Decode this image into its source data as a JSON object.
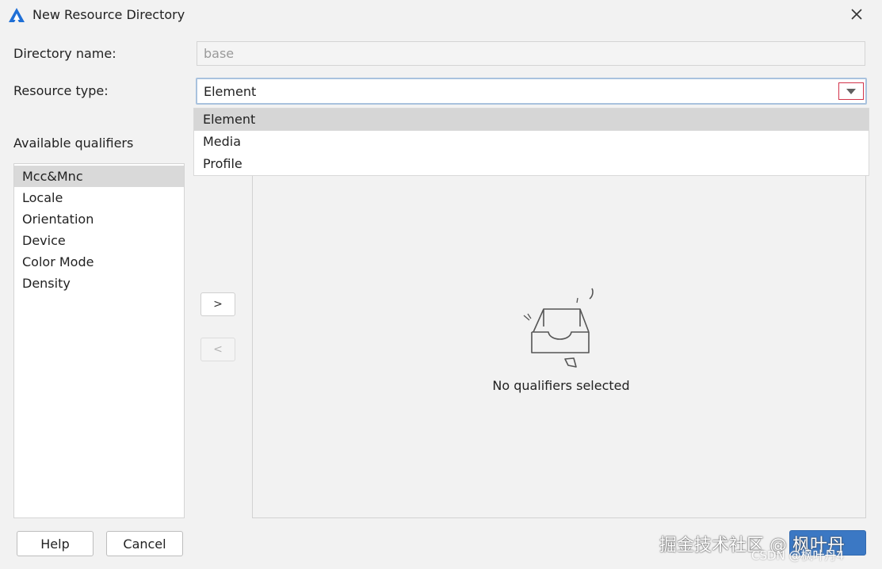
{
  "window": {
    "title": "New Resource Directory"
  },
  "form": {
    "directory_name_label": "Directory name:",
    "directory_name_value": "base",
    "resource_type_label": "Resource type:",
    "resource_type_value": "Element"
  },
  "dropdown": {
    "options": [
      "Element",
      "Media",
      "Profile"
    ],
    "selected": "Element"
  },
  "qualifiers": {
    "available_label": "Available qualifiers",
    "items": [
      "Mcc&Mnc",
      "Locale",
      "Orientation",
      "Device",
      "Color Mode",
      "Density"
    ],
    "selected": "Mcc&Mnc",
    "add_label": ">",
    "remove_label": "<",
    "empty_text": "No qualifiers selected"
  },
  "buttons": {
    "help": "Help",
    "cancel": "Cancel",
    "ok": ""
  },
  "watermark": {
    "main": "掘金技术社区 @ 枫叶丹",
    "sub": "CSDN @枫叶丹4"
  },
  "colors": {
    "primary": "#3b78c4",
    "highlight_border": "#d2334a",
    "selection": "#d6d6d6"
  }
}
